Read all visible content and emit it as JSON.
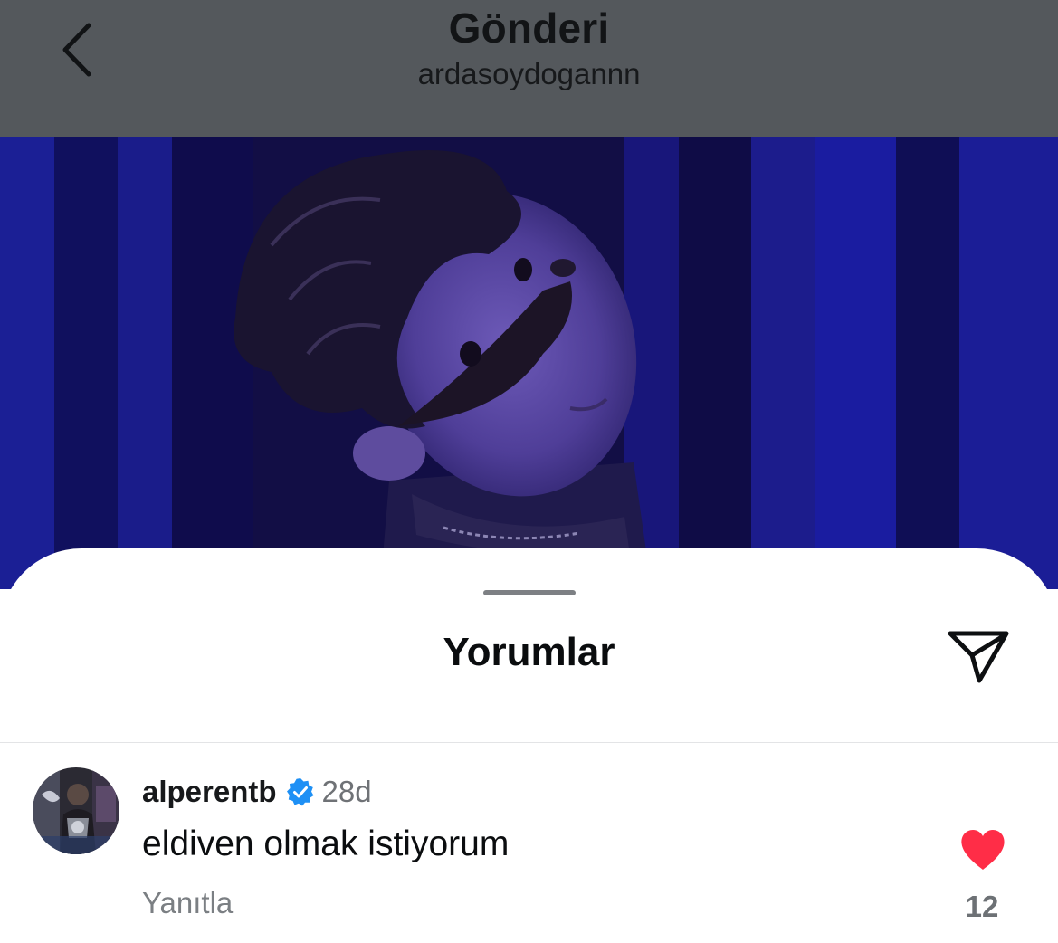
{
  "header": {
    "title": "Gönderi",
    "subtitle": "ardasoydogannn",
    "back_icon": "chevron-left-icon"
  },
  "post": {
    "image": "post-photo"
  },
  "comments_sheet": {
    "title": "Yorumlar",
    "share_icon": "paper-plane-icon",
    "comments": [
      {
        "username": "alperentb",
        "verified": true,
        "time": "28d",
        "text": "eldiven olmak istiyorum",
        "reply_label": "Yanıtla",
        "likes": "12",
        "liked": true
      }
    ]
  },
  "colors": {
    "like_red": "#ff2d47",
    "verified_blue": "#1da1f2",
    "dim_overlay": "#54585c"
  }
}
